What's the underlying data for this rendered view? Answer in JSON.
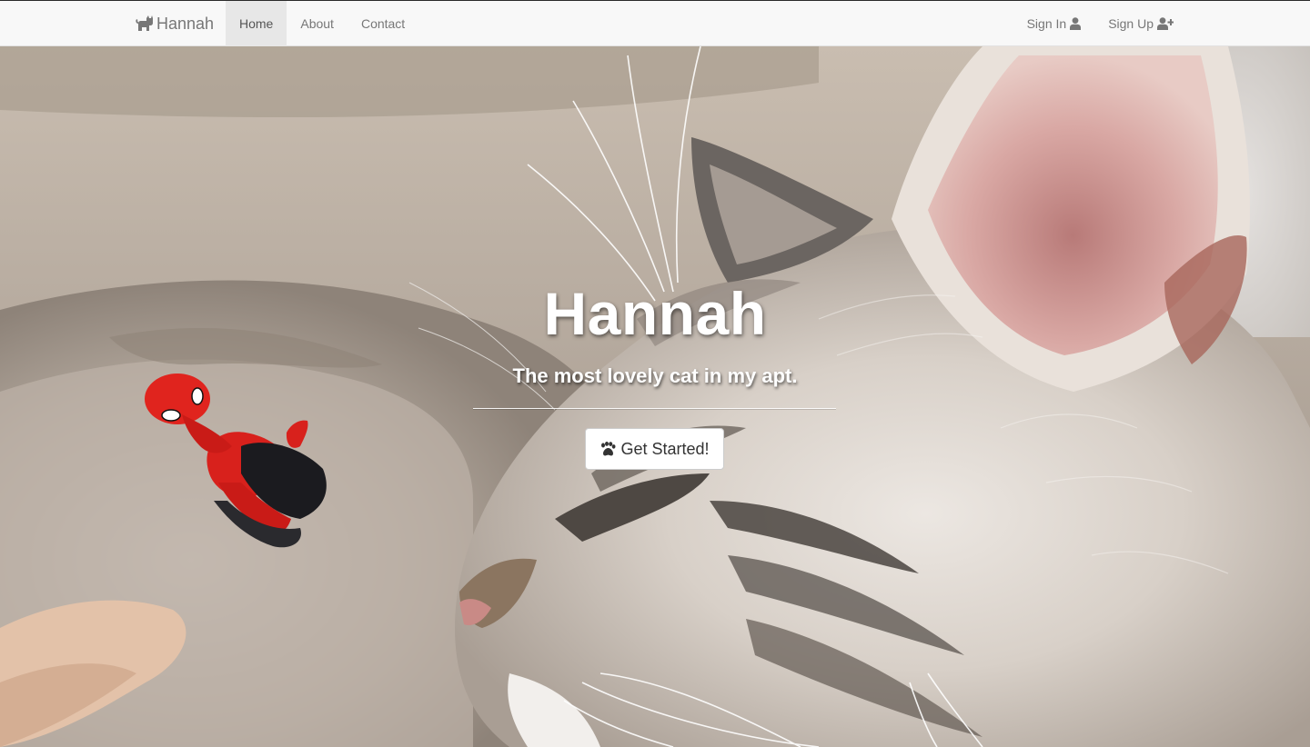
{
  "navbar": {
    "brand": {
      "label": "Hannah",
      "icon": "cat-icon"
    },
    "left_items": [
      {
        "label": "Home",
        "active": true
      },
      {
        "label": "About",
        "active": false
      },
      {
        "label": "Contact",
        "active": false
      }
    ],
    "right_items": [
      {
        "label": "Sign In",
        "icon": "user-icon"
      },
      {
        "label": "Sign Up",
        "icon": "user-plus-icon"
      }
    ]
  },
  "hero": {
    "title": "Hannah",
    "subtitle": "The most lovely cat in my apt.",
    "cta": {
      "label": "Get Started!",
      "icon": "paw-icon"
    }
  },
  "colors": {
    "navbar_bg": "#f8f8f8",
    "nav_text": "#777777",
    "nav_active_bg": "#e7e7e7",
    "hero_text": "#ffffff",
    "button_bg": "#ffffff"
  }
}
